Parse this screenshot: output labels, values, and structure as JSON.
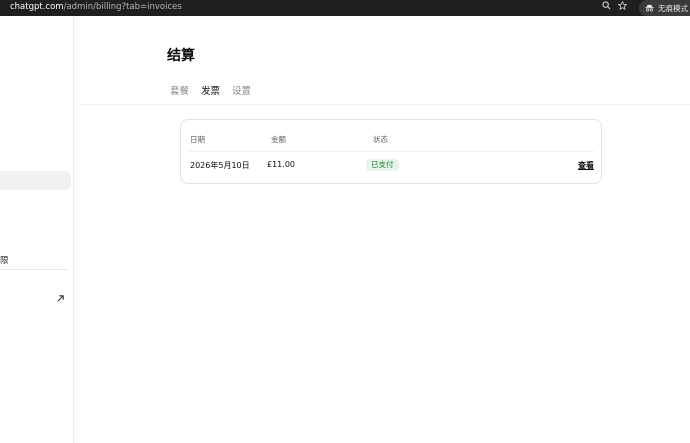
{
  "browser": {
    "url_host": "chatgpt.com",
    "url_path": "/admin/billing?tab=invoices",
    "incognito_label": "无痕模式"
  },
  "sidebar": {
    "partial_label": "限"
  },
  "page": {
    "title": "结算",
    "tabs": [
      {
        "label": "套餐",
        "active": false
      },
      {
        "label": "发票",
        "active": true
      },
      {
        "label": "设置",
        "active": false
      }
    ]
  },
  "invoices": {
    "columns": {
      "date": "日期",
      "amount": "金额",
      "status": "状态"
    },
    "rows": [
      {
        "date": "2026年5月10日",
        "amount": "£11.00",
        "status": "已支付",
        "action": "查看"
      }
    ]
  },
  "colors": {
    "badge_bg": "#e6f4ea",
    "badge_text": "#1a7f37",
    "chrome_bg": "#1f1f1f"
  }
}
